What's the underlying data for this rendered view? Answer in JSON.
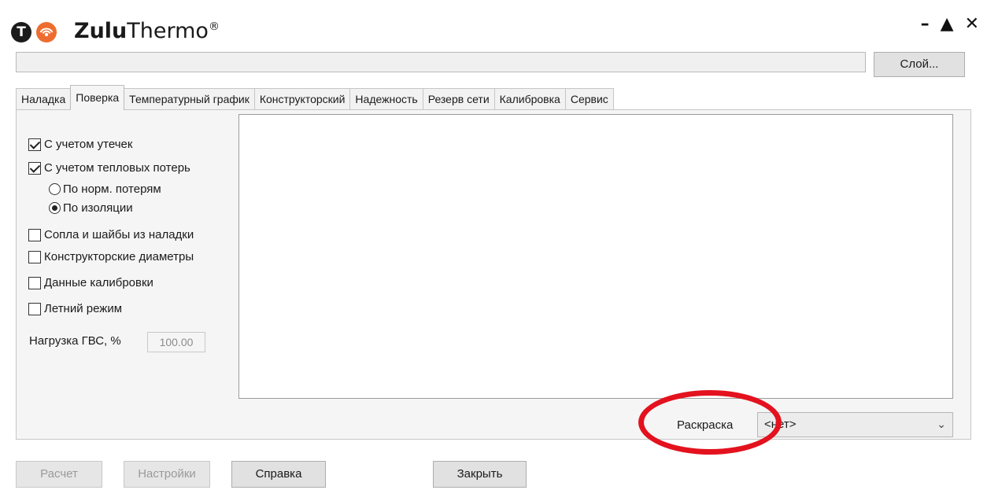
{
  "app": {
    "logo_letter": "T",
    "title_bold": "Zulu",
    "title_rest": "Thermo",
    "title_mark": "®"
  },
  "window_controls": {
    "minimize": "–",
    "maximize": "▲",
    "close": "✕"
  },
  "layer": {
    "value": "",
    "button_label": "Слой..."
  },
  "tabs": [
    {
      "label": "Наладка",
      "active": false
    },
    {
      "label": "Поверка",
      "active": true
    },
    {
      "label": "Температурный график",
      "active": false
    },
    {
      "label": "Конструкторский",
      "active": false
    },
    {
      "label": "Надежность",
      "active": false
    },
    {
      "label": "Резерв сети",
      "active": false
    },
    {
      "label": "Калибровка",
      "active": false
    },
    {
      "label": "Сервис",
      "active": false
    }
  ],
  "options": {
    "leaks": {
      "label": "С учетом утечек",
      "checked": true
    },
    "heat_loss": {
      "label": "С учетом тепловых потерь",
      "checked": true
    },
    "norm_losses": {
      "label": "По норм. потерям",
      "selected": false
    },
    "insulation": {
      "label": "По изоляции",
      "selected": true
    },
    "nozzles": {
      "label": "Сопла и шайбы из наладки",
      "checked": false
    },
    "design_diameters": {
      "label": "Конструкторские диаметры",
      "checked": false
    },
    "calibration_data": {
      "label": "Данные калибровки",
      "checked": false
    },
    "summer_mode": {
      "label": "Летний режим",
      "checked": false
    }
  },
  "hot_water_load": {
    "label": "Нагрузка ГВС, %",
    "value": "100.00"
  },
  "coloring": {
    "label": "Раскраска",
    "value": "<нет>"
  },
  "buttons": {
    "calc": "Расчет",
    "settings": "Настройки",
    "help": "Справка",
    "close": "Закрыть"
  },
  "colors": {
    "highlight": "#e3121e",
    "logo_orange": "#ee6c2f",
    "panel_bg": "#f5f5f5"
  }
}
